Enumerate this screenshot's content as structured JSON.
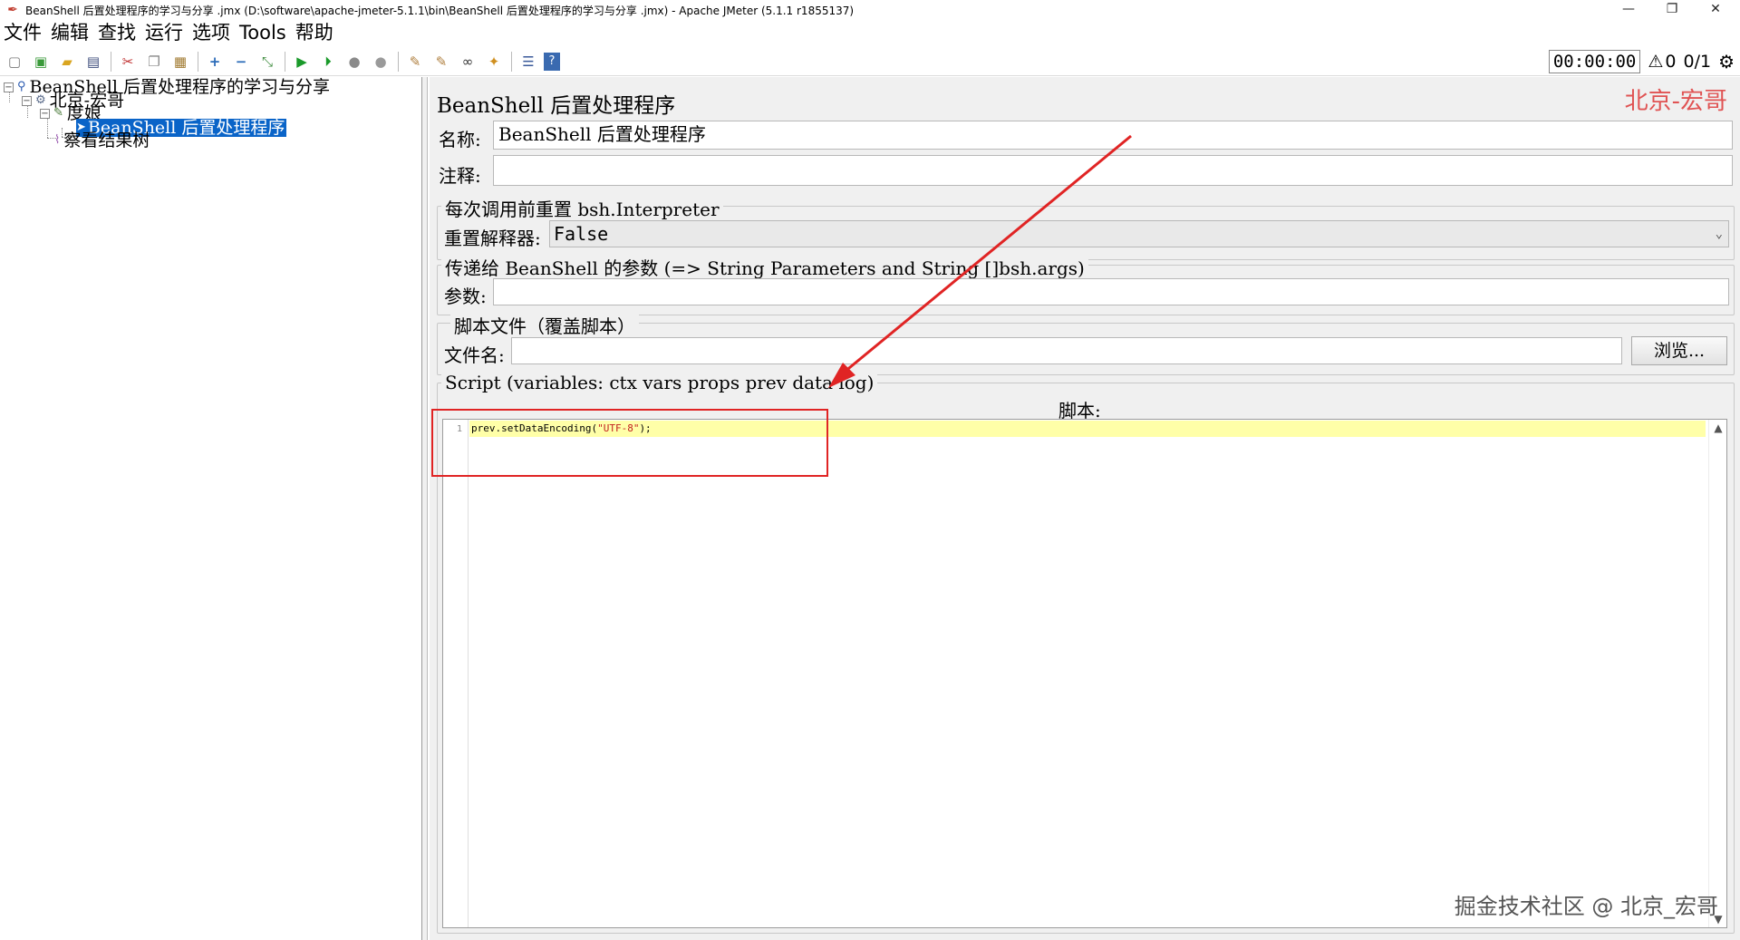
{
  "window": {
    "title": "BeanShell 后置处理程序的学习与分享 .jmx (D:\\software\\apache-jmeter-5.1.1\\bin\\BeanShell 后置处理程序的学习与分享 .jmx) - Apache JMeter (5.1.1 r1855137)",
    "minimize": "—",
    "restore": "❐",
    "close": "✕"
  },
  "menu": [
    "文件",
    "编辑",
    "查找",
    "运行",
    "选项",
    "Tools",
    "帮助"
  ],
  "toolbar": {
    "timer": "00:00:00",
    "warning_count": "0",
    "threads": "0/1"
  },
  "tree": {
    "root": "BeanShell 后置处理程序的学习与分享",
    "thread_group": "北京-宏哥",
    "sampler": "度娘",
    "selected": "BeanShell 后置处理程序",
    "listener": "察看结果树"
  },
  "panel": {
    "title": "BeanShell 后置处理程序",
    "watermark": "北京-宏哥",
    "name_label": "名称:",
    "name_value": "BeanShell 后置处理程序",
    "comment_label": "注释:",
    "comment_value": "",
    "reset_group": "每次调用前重置 bsh.Interpreter",
    "reset_label": "重置解释器:",
    "reset_value": "False",
    "params_group": "传递给 BeanShell 的参数 (=> String Parameters and String []bsh.args)",
    "params_label": "参数:",
    "params_value": "",
    "file_group": "脚本文件（覆盖脚本）",
    "file_label": "文件名:",
    "file_value": "",
    "browse_label": "浏览...",
    "script_group": "Script (variables: ctx vars props prev data log)",
    "script_label": "脚本:",
    "code_line_number": "1",
    "code_prefix": "prev.setDataEncoding(",
    "code_string": "\"UTF-8\"",
    "code_suffix": ");"
  },
  "watermark_bottom": "掘金技术社区 @ 北京_宏哥",
  "colors": {
    "selection": "#0a64c8",
    "annotation_red": "#e02424",
    "highlight_line": "#ffffa8",
    "panel_bg": "#f0f0f0"
  }
}
